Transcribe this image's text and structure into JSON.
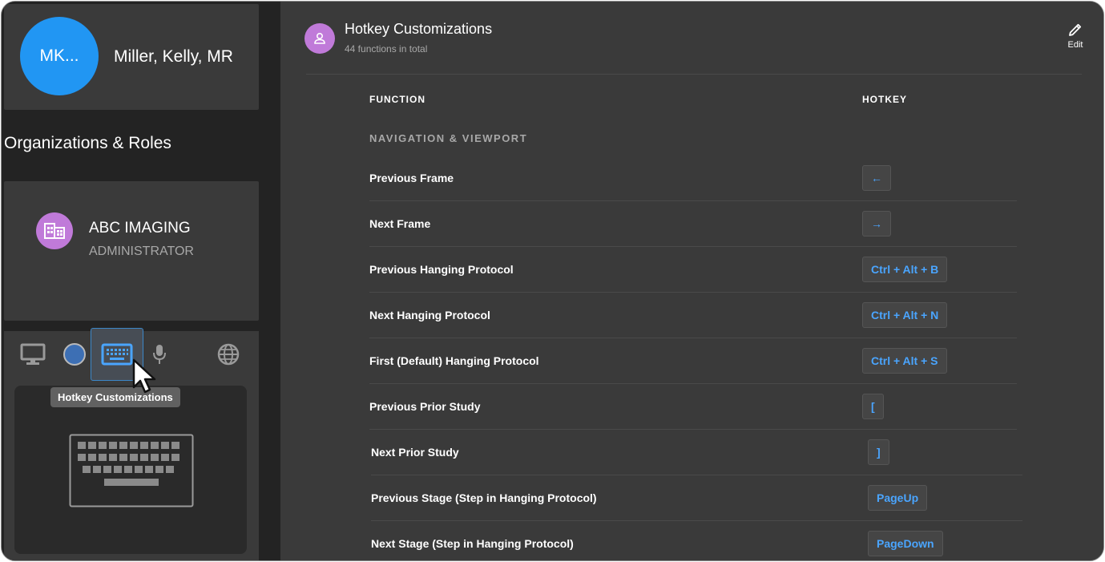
{
  "profile": {
    "initials": "MK...",
    "name": "Miller, Kelly, MR"
  },
  "organizations": {
    "heading": "Organizations & Roles",
    "items": [
      {
        "name": "ABC IMAGING",
        "role": "ADMINISTRATOR"
      }
    ]
  },
  "settings_tabs": {
    "icons": [
      "monitor-icon",
      "circle-icon",
      "keyboard-icon",
      "microphone-icon",
      "globe-icon"
    ],
    "selected": "keyboard-icon",
    "tooltip": "Hotkey Customizations"
  },
  "header": {
    "title": "Hotkey Customizations",
    "subtitle": "44 functions in total",
    "edit_label": "Edit"
  },
  "table": {
    "columns": {
      "function": "FUNCTION",
      "hotkey": "HOTKEY"
    },
    "section": "NAVIGATION & VIEWPORT",
    "rows": [
      {
        "function": "Previous Frame",
        "hotkey": "←"
      },
      {
        "function": "Next Frame",
        "hotkey": "→"
      },
      {
        "function": "Previous Hanging Protocol",
        "hotkey": "Ctrl + Alt + B"
      },
      {
        "function": "Next Hanging Protocol",
        "hotkey": "Ctrl + Alt + N"
      },
      {
        "function": "First (Default) Hanging Protocol",
        "hotkey": "Ctrl + Alt + S"
      },
      {
        "function": "Previous Prior Study",
        "hotkey": "["
      },
      {
        "function": "Next Prior Study",
        "hotkey": "]"
      },
      {
        "function": "Previous Stage (Step in Hanging Protocol)",
        "hotkey": "PageUp"
      },
      {
        "function": "Next Stage (Step in Hanging Protocol)",
        "hotkey": "PageDown"
      }
    ]
  },
  "colors": {
    "accent_blue": "#2196f3",
    "hotkey_text": "#4aa5ff",
    "purple": "#c07ad9",
    "panel": "#3a3a3a",
    "background": "#232323"
  }
}
